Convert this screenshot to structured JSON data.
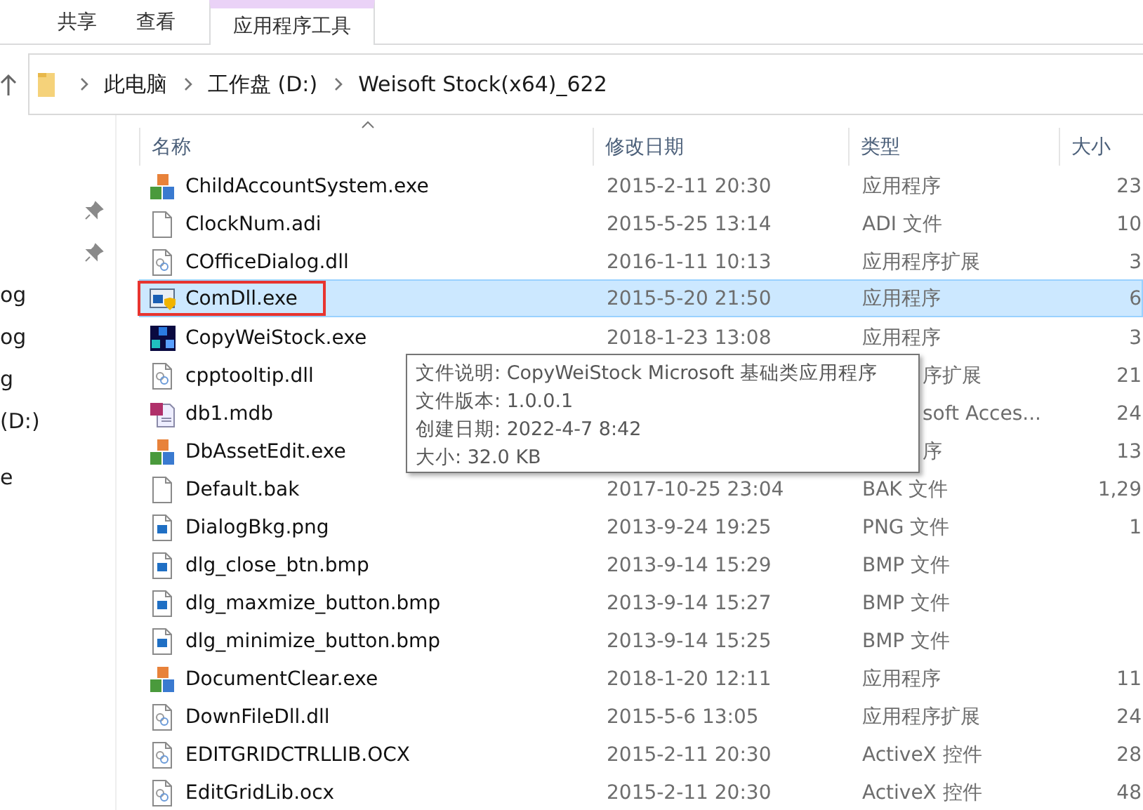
{
  "ribbon_tabs": [
    {
      "label": "共享",
      "selected": false
    },
    {
      "label": "查看",
      "selected": false
    },
    {
      "label": "应用程序工具",
      "selected": true
    }
  ],
  "address": {
    "crumbs": [
      "此电脑",
      "工作盘 (D:)",
      "Weisoft Stock(x64)_622"
    ]
  },
  "sidebar": {
    "items": [
      {
        "pinned": true
      },
      {
        "pinned": true
      },
      {
        "label": "og",
        "pinned": false
      },
      {
        "label": "og",
        "pinned": false
      },
      {
        "label": "g",
        "pinned": false
      },
      {
        "label": "(D:)",
        "pinned": false
      },
      {
        "label": "e",
        "pinned": false
      }
    ]
  },
  "table": {
    "columns": [
      "名称",
      "修改日期",
      "类型",
      "大小"
    ],
    "rows": [
      {
        "kind": "mfc",
        "name": "ChildAccountSystem.exe",
        "date": "2015-2-11 20:30",
        "type": "应用程序",
        "size": "23",
        "selected": false,
        "highlighted": false
      },
      {
        "kind": "blank",
        "name": "ClockNum.adi",
        "date": "2015-5-25 13:14",
        "type": "ADI 文件",
        "size": "10",
        "selected": false,
        "highlighted": false
      },
      {
        "kind": "dll",
        "name": "COfficeDialog.dll",
        "date": "2016-1-11 10:13",
        "type": "应用程序扩展",
        "size": "3",
        "selected": false,
        "highlighted": false
      },
      {
        "kind": "window",
        "name": "ComDll.exe",
        "date": "2015-5-20 21:50",
        "type": "应用程序",
        "size": "6",
        "selected": true,
        "highlighted": true
      },
      {
        "kind": "cubes",
        "name": "CopyWeiStock.exe",
        "date": "2018-1-23 13:08",
        "type": "应用程序",
        "size": "3",
        "selected": false,
        "highlighted": false
      },
      {
        "kind": "dll",
        "name": "cpptooltip.dll",
        "type": "序扩展",
        "type_partly_hidden": true,
        "size": "21",
        "selected": false,
        "highlighted": false
      },
      {
        "kind": "access",
        "name": "db1.mdb",
        "type": "soft Acces...",
        "type_partly_hidden": true,
        "size": "24",
        "selected": false,
        "highlighted": false
      },
      {
        "kind": "mfc",
        "name": "DbAssetEdit.exe",
        "type": "序",
        "type_partly_hidden": true,
        "size": "13",
        "selected": false,
        "highlighted": false
      },
      {
        "kind": "blank",
        "name": "Default.bak",
        "date": "2017-10-25 23:04",
        "type": "BAK 文件",
        "size": "1,29",
        "selected": false,
        "highlighted": false
      },
      {
        "kind": "image",
        "name": "DialogBkg.png",
        "date": "2013-9-24 19:25",
        "type": "PNG 文件",
        "size": "1",
        "selected": false,
        "highlighted": false
      },
      {
        "kind": "image",
        "name": "dlg_close_btn.bmp",
        "date": "2013-9-14 15:29",
        "type": "BMP 文件",
        "selected": false,
        "highlighted": false
      },
      {
        "kind": "image",
        "name": "dlg_maxmize_button.bmp",
        "date": "2013-9-14 15:27",
        "type": "BMP 文件",
        "selected": false,
        "highlighted": false
      },
      {
        "kind": "image",
        "name": "dlg_minimize_button.bmp",
        "date": "2013-9-14 15:25",
        "type": "BMP 文件",
        "selected": false,
        "highlighted": false
      },
      {
        "kind": "mfc",
        "name": "DocumentClear.exe",
        "date": "2018-1-20 12:11",
        "type": "应用程序",
        "size": "11",
        "selected": false,
        "highlighted": false
      },
      {
        "kind": "dll",
        "name": "DownFileDll.dll",
        "date": "2015-5-6 13:05",
        "type": "应用程序扩展",
        "size": "24",
        "selected": false,
        "highlighted": false
      },
      {
        "kind": "dll",
        "name": "EDITGRIDCTRLLIB.OCX",
        "date": "2015-2-11 20:30",
        "type": "ActiveX 控件",
        "size": "28",
        "selected": false,
        "highlighted": false
      },
      {
        "kind": "dll",
        "name": "EditGridLib.ocx",
        "date": "2015-2-11 20:30",
        "type": "ActiveX 控件",
        "size": "48",
        "selected": false,
        "highlighted": false
      }
    ]
  },
  "tooltip": {
    "lines": [
      "文件说明: CopyWeiStock Microsoft 基础类应用程序",
      "文件版本: 1.0.0.1",
      "创建日期: 2022-4-7 8:42",
      "大小: 32.0 KB"
    ]
  }
}
